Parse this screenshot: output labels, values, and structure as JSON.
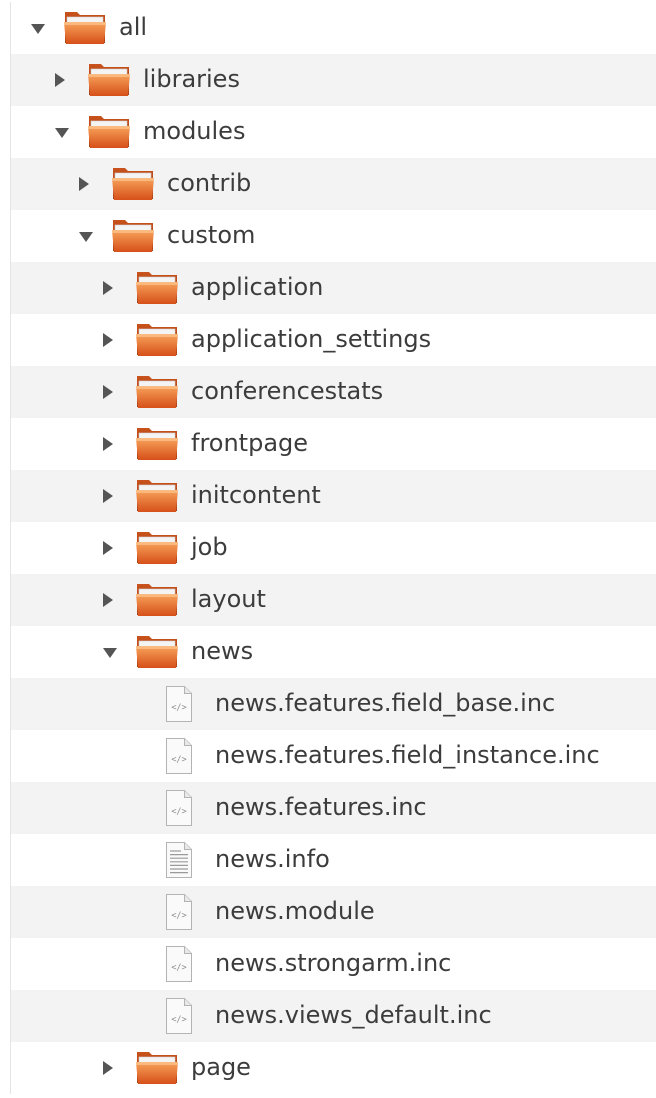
{
  "tree": [
    {
      "label": "all",
      "type": "folder",
      "state": "expanded",
      "depth": 0
    },
    {
      "label": "libraries",
      "type": "folder",
      "state": "collapsed",
      "depth": 1
    },
    {
      "label": "modules",
      "type": "folder",
      "state": "expanded",
      "depth": 1
    },
    {
      "label": "contrib",
      "type": "folder",
      "state": "collapsed",
      "depth": 2
    },
    {
      "label": "custom",
      "type": "folder",
      "state": "expanded",
      "depth": 2
    },
    {
      "label": "application",
      "type": "folder",
      "state": "collapsed",
      "depth": 3
    },
    {
      "label": "application_settings",
      "type": "folder",
      "state": "collapsed",
      "depth": 3
    },
    {
      "label": "conferencestats",
      "type": "folder",
      "state": "collapsed",
      "depth": 3
    },
    {
      "label": "frontpage",
      "type": "folder",
      "state": "collapsed",
      "depth": 3
    },
    {
      "label": "initcontent",
      "type": "folder",
      "state": "collapsed",
      "depth": 3
    },
    {
      "label": "job",
      "type": "folder",
      "state": "collapsed",
      "depth": 3
    },
    {
      "label": "layout",
      "type": "folder",
      "state": "collapsed",
      "depth": 3
    },
    {
      "label": "news",
      "type": "folder",
      "state": "expanded",
      "depth": 3
    },
    {
      "label": "news.features.field_base.inc",
      "type": "code-file",
      "depth": 4
    },
    {
      "label": "news.features.field_instance.inc",
      "type": "code-file",
      "depth": 4
    },
    {
      "label": "news.features.inc",
      "type": "code-file",
      "depth": 4
    },
    {
      "label": "news.info",
      "type": "text-file",
      "depth": 4
    },
    {
      "label": "news.module",
      "type": "code-file",
      "depth": 4
    },
    {
      "label": "news.strongarm.inc",
      "type": "code-file",
      "depth": 4
    },
    {
      "label": "news.views_default.inc",
      "type": "code-file",
      "depth": 4
    },
    {
      "label": "page",
      "type": "folder",
      "state": "collapsed",
      "depth": 3
    }
  ],
  "icons": {
    "folder": "folder-icon",
    "code-file": "code-file-icon",
    "text-file": "text-file-icon",
    "collapsed": "expand-arrow-icon",
    "expanded": "collapse-arrow-icon"
  },
  "colors": {
    "folder_top": "#f7a25a",
    "folder_bottom": "#d6501a",
    "arrow": "#555555",
    "row_alt": "#f3f3f3",
    "text": "#3c3c3c"
  }
}
